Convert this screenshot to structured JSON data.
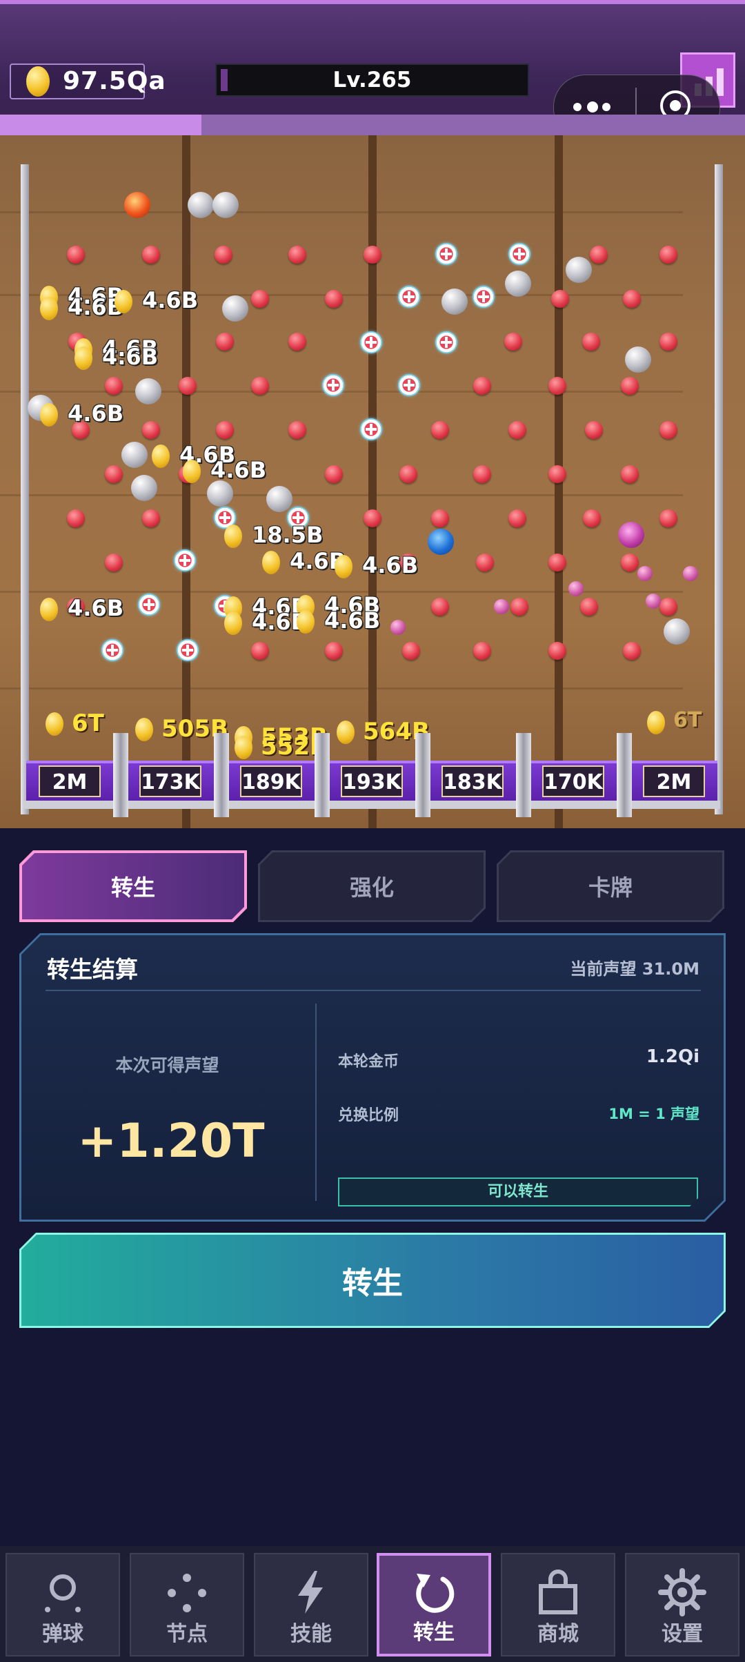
{
  "header": {
    "coins": "97.5Qa",
    "level": "Lv.265",
    "level_progress": 0.02,
    "xp_progress": 0.27
  },
  "board": {
    "floating_labels": [
      "4.6B",
      "4.6B",
      "4.6B",
      "4.6B",
      "4.6B",
      "4.6B",
      "4.6B",
      "4.6B",
      "18.5B",
      "4.6B",
      "4.6B",
      "4.6B",
      "4.6B",
      "4.6B",
      "4.6B",
      "4.6B"
    ],
    "slot_amounts": [
      "6T",
      "505B",
      "553B",
      "552B",
      "564B",
      "6T"
    ],
    "buckets": [
      "2M",
      "173K",
      "189K",
      "193K",
      "183K",
      "170K",
      "2M"
    ]
  },
  "tabs": [
    {
      "label": "转生",
      "active": true
    },
    {
      "label": "强化",
      "active": false
    },
    {
      "label": "卡牌",
      "active": false
    }
  ],
  "panel": {
    "title": "转生结算",
    "current_prestige": "当前声望 31.0M",
    "gain_label": "本次可得声望",
    "gain_value": "+1.20T",
    "round_coins_label": "本轮金币",
    "round_coins_value": "1.2Qi",
    "ratio_label": "兑换比例",
    "ratio_value": "1M = 1 声望",
    "status": "可以转生"
  },
  "rebirth_button": "转生",
  "colors": {
    "accent": "#c98be8",
    "ready": "#39c2a8",
    "gain": "#ffe7a3"
  },
  "nav": [
    {
      "label": "弹球",
      "icon": "ball-icon"
    },
    {
      "label": "节点",
      "icon": "nodes-icon"
    },
    {
      "label": "技能",
      "icon": "lightning-icon"
    },
    {
      "label": "转生",
      "icon": "refresh-icon",
      "active": true
    },
    {
      "label": "商城",
      "icon": "shop-bag-icon"
    },
    {
      "label": "设置",
      "icon": "gear-icon"
    }
  ]
}
